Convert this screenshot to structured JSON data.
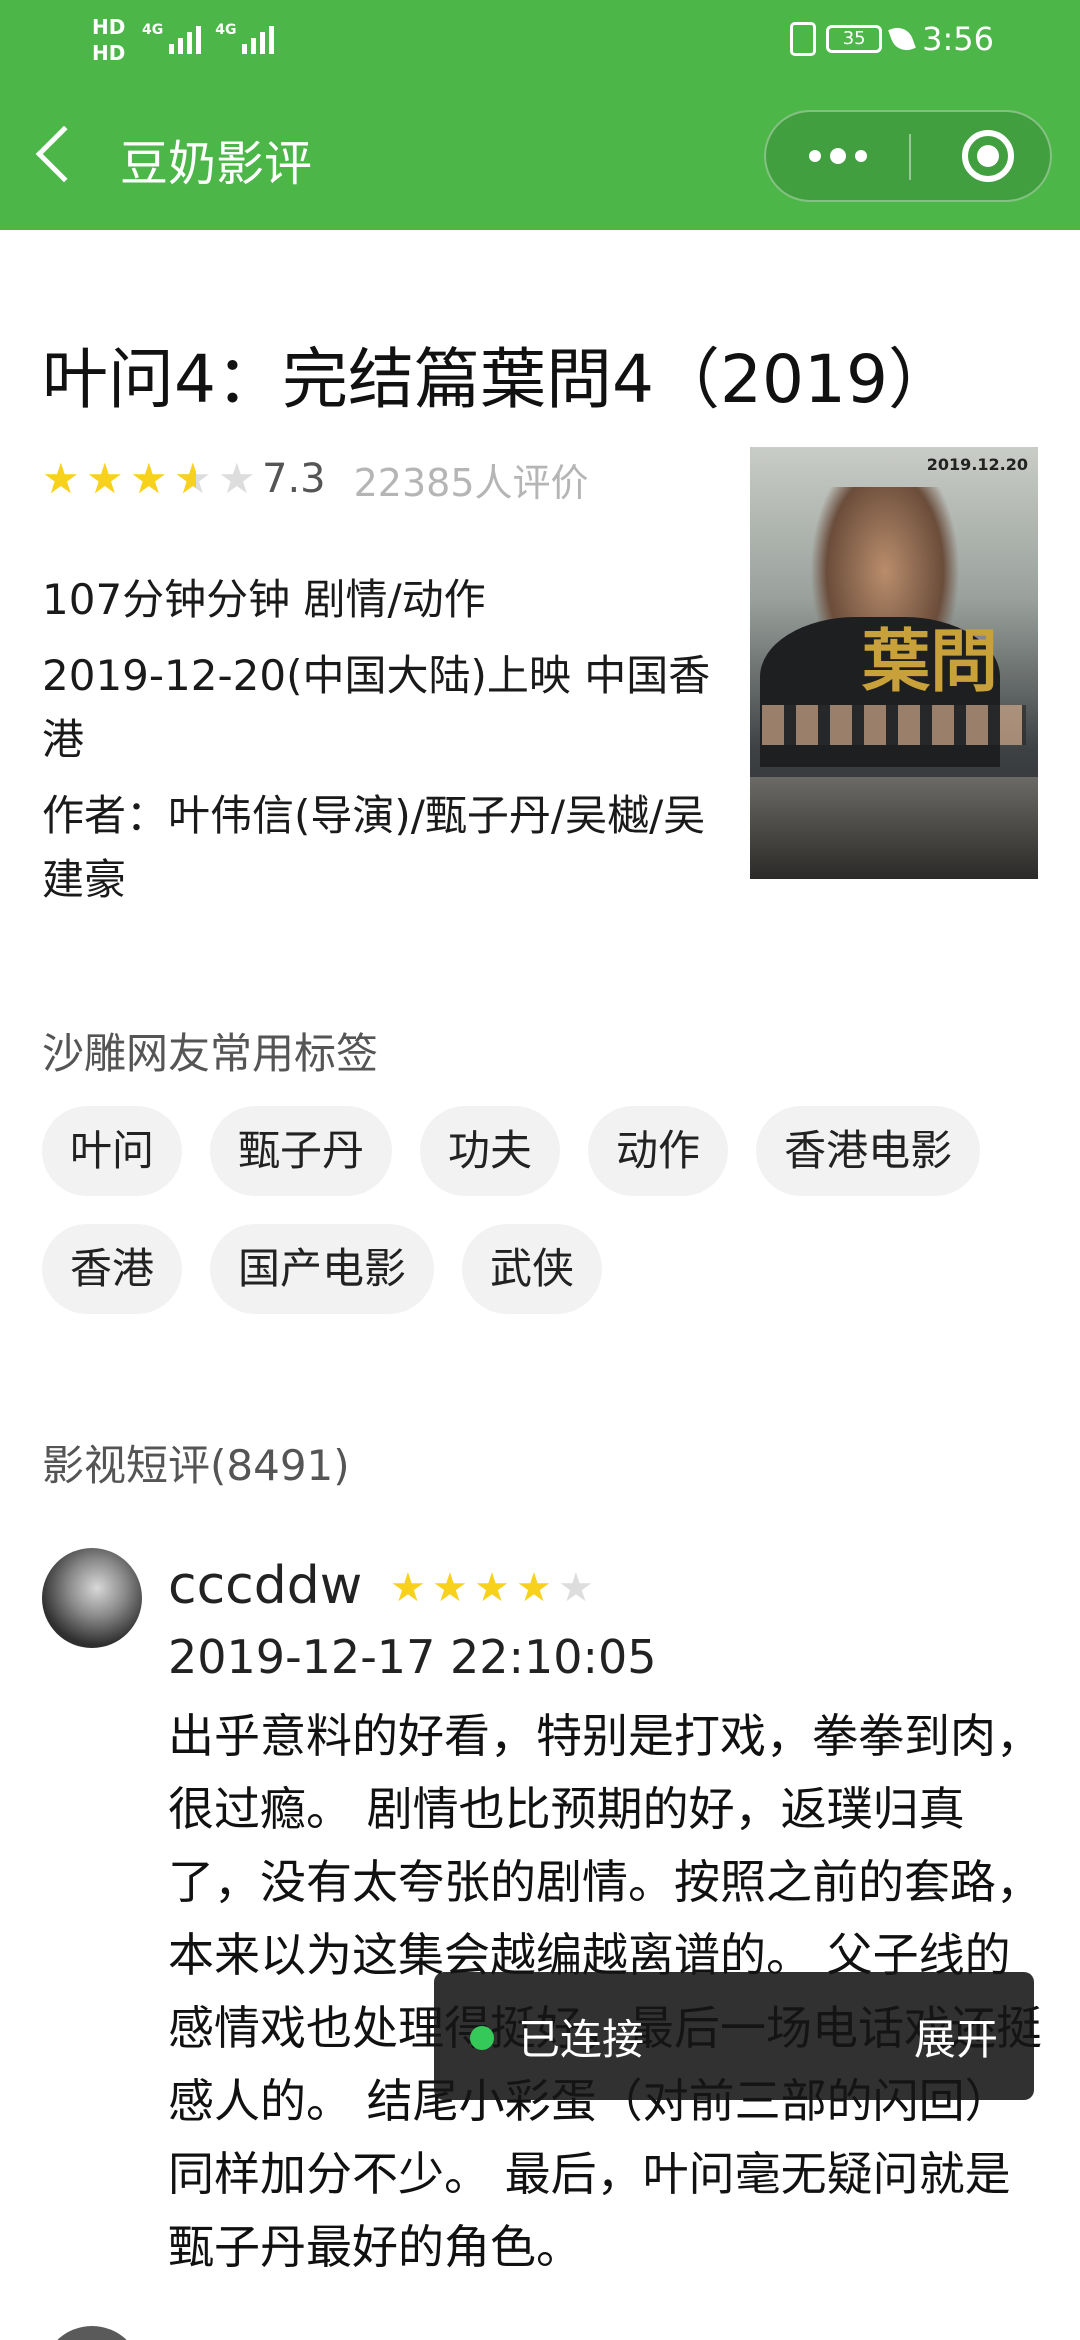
{
  "status_bar": {
    "left_tags": [
      "HD",
      "HD"
    ],
    "signal_labels": [
      "4G",
      "4G"
    ],
    "battery": "35",
    "time": "3:56"
  },
  "nav": {
    "title": "豆奶影评"
  },
  "movie": {
    "title": "叶问4：完结篇葉問4（2019）",
    "rating_score": "7.3",
    "rating_stars": 3.5,
    "rating_count": "22385人评价",
    "duration_genre": "107分钟分钟 剧情/动作",
    "release": "2019-12-20(中国大陆)上映 中国香港",
    "credits": "作者：叶伟信(导演)/甄子丹/吴樾/吴建豪",
    "poster": {
      "date_text": "2019.12.20",
      "title_glyph": "葉問"
    }
  },
  "tags": {
    "label": "沙雕网友常用标签",
    "items": [
      "叶问",
      "甄子丹",
      "功夫",
      "动作",
      "香港电影",
      "香港",
      "国产电影",
      "武侠"
    ]
  },
  "comments": {
    "label": "影视短评(8491)",
    "items": [
      {
        "user": "cccddw",
        "stars": 4,
        "date": "2019-12-17 22:10:05",
        "text": "出乎意料的好看，特别是打戏，拳拳到肉，很过瘾。 剧情也比预期的好，返璞归真了，没有太夸张的剧情。按照之前的套路，本来以为这集会越编越离谱的。 父子线的感情戏也处理得挺好，最后一场电话戏还挺感人的。 结尾小彩蛋（对前三部的闪回）同样加分不少。 最后，叶问毫无疑问就是甄子丹最好的角色。"
      }
    ]
  },
  "toast": {
    "status": "已连接",
    "action": "展开"
  },
  "colors": {
    "header_green": "#4cb649",
    "star_yellow": "#f7d11c",
    "star_gray": "#dddddd",
    "toast_dot": "#35c95a"
  }
}
